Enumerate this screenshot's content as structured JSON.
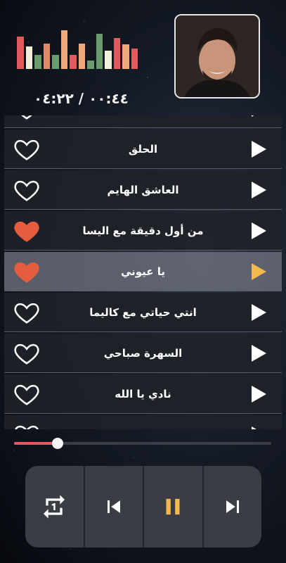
{
  "now_playing": {
    "time_display": "٠٠:٤٤ / ٠٤:٢٢",
    "progress": 0.17
  },
  "visualizer_levels": [
    0.8,
    0.55,
    0.35,
    0.62,
    0.35,
    0.95,
    0.35,
    0.62,
    0.2,
    0.86,
    0.45,
    0.75,
    0.6,
    0.5
  ],
  "visualizer_colors": [
    "#e05a5e",
    "#f2f0d8",
    "#6a9a6e",
    "#e08a6a",
    "#6a9a6e",
    "#f2a878",
    "#e05a5e",
    "#f2a878",
    "#6a9a6e",
    "#6a9a6e",
    "#f2f0d8",
    "#e05a5e",
    "#f2a878",
    "#e05a5e"
  ],
  "colors": {
    "accent": "#f5b84c",
    "heart_filled": "#e45d3f",
    "seek": "#ec5660"
  },
  "playlist": [
    {
      "title": "",
      "liked": false,
      "active": false
    },
    {
      "title": "الحلق",
      "liked": false,
      "active": false
    },
    {
      "title": "العاشق الهايم",
      "liked": false,
      "active": false
    },
    {
      "title": "من أول دقيقة مع اليسا",
      "liked": true,
      "active": false
    },
    {
      "title": "يا عيوني",
      "liked": true,
      "active": true
    },
    {
      "title": "انتي حياتي مع كاليما",
      "liked": false,
      "active": false
    },
    {
      "title": "السهرة صباحي",
      "liked": false,
      "active": false
    },
    {
      "title": "نادي يا الله",
      "liked": false,
      "active": false
    },
    {
      "title": "",
      "liked": false,
      "active": false
    }
  ],
  "controls": [
    {
      "name": "repeat-one-button",
      "icon": "repeat-one-icon"
    },
    {
      "name": "previous-button",
      "icon": "skip-previous-icon"
    },
    {
      "name": "pause-button",
      "icon": "pause-icon"
    },
    {
      "name": "next-button",
      "icon": "skip-next-icon"
    }
  ]
}
